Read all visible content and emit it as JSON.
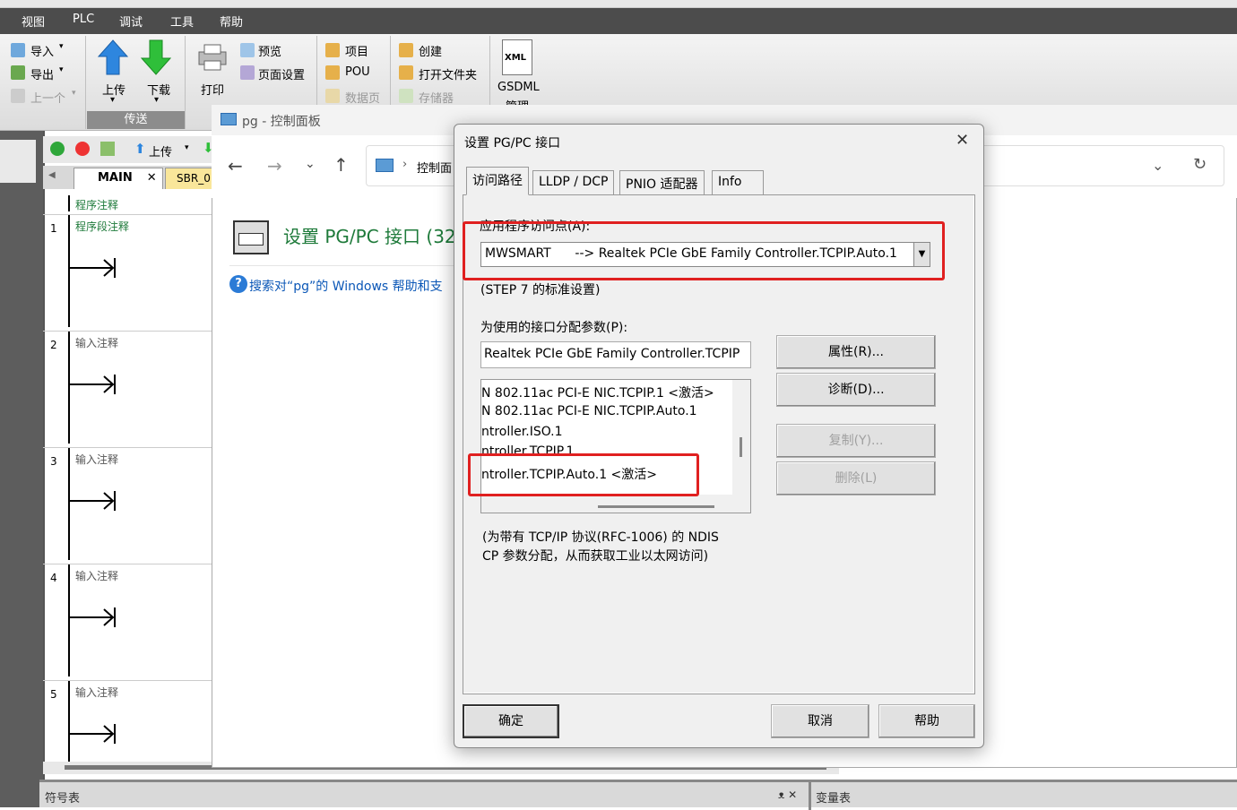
{
  "menubar": {
    "items": [
      "视图",
      "PLC",
      "调试",
      "工具",
      "帮助"
    ]
  },
  "ribbon": {
    "import": "导入",
    "export": "导出",
    "prev": "上一个",
    "upload": "上传",
    "download": "下载",
    "transfer_group": "传送",
    "print": "打印",
    "preview": "预览",
    "page_setup": "页面设置",
    "project": "项目",
    "pou": "POU",
    "data_page": "数据页",
    "create": "创建",
    "open_folder": "打开文件夹",
    "memory": "存储器",
    "gsdml": "GSDML",
    "gsdml_sub": "管理",
    "xml": "XML"
  },
  "editor": {
    "upload_btn": "上传",
    "tab_main": "MAIN",
    "tab_sbr": "SBR_0",
    "program_comment": "程序注释",
    "networks": [
      {
        "num": "1",
        "comment": "程序段注释"
      },
      {
        "num": "2",
        "comment": "输入注释"
      },
      {
        "num": "3",
        "comment": "输入注释"
      },
      {
        "num": "4",
        "comment": "输入注释"
      },
      {
        "num": "5",
        "comment": "输入注释"
      }
    ]
  },
  "bottom": {
    "symbol_table": "符号表",
    "pin": "ᴥ ✕",
    "var_table": "变量表"
  },
  "control_panel": {
    "title": "pg - 控制面板",
    "breadcrumb": "控制面",
    "heading": "设置 PG/PC 接口 (32",
    "help_link": "搜索对“pg”的 Windows 帮助和支"
  },
  "dialog": {
    "title": "设置 PG/PC 接口",
    "tabs": [
      "访问路径",
      "LLDP / DCP",
      "PNIO 适配器",
      "Info"
    ],
    "access_point_label": "应用程序访问点(A):",
    "access_point_value": "MWSMART      --> Realtek PCIe GbE Family Controller.TCPIP.Auto.1",
    "std_setting": "(STEP 7 的标准设置)",
    "param_label": "为使用的接口分配参数(P):",
    "param_value": "Realtek PCIe GbE Family Controller.TCPIP",
    "list_items": [
      "N 802.11ac PCI-E NIC.TCPIP.1  <激活>",
      "N 802.11ac PCI-E NIC.TCPIP.Auto.1",
      "ntroller.ISO.1",
      "ntroller.TCPIP.1",
      "ntroller.TCPIP.Auto.1  <激活>"
    ],
    "btn_properties": "属性(R)...",
    "btn_diagnose": "诊断(D)...",
    "btn_copy": "复制(Y)...",
    "btn_delete": "删除(L)",
    "desc_line1": "(为带有 TCP/IP 协议(RFC-1006) 的 NDIS",
    "desc_line2": "CP 参数分配，从而获取工业以太网访问)",
    "ok": "确定",
    "cancel": "取消",
    "help": "帮助",
    "close": "✕"
  },
  "colors": {
    "highlight_red": "#e02020",
    "heading_green": "#1e7a3a",
    "link_blue": "#0b57b7"
  }
}
